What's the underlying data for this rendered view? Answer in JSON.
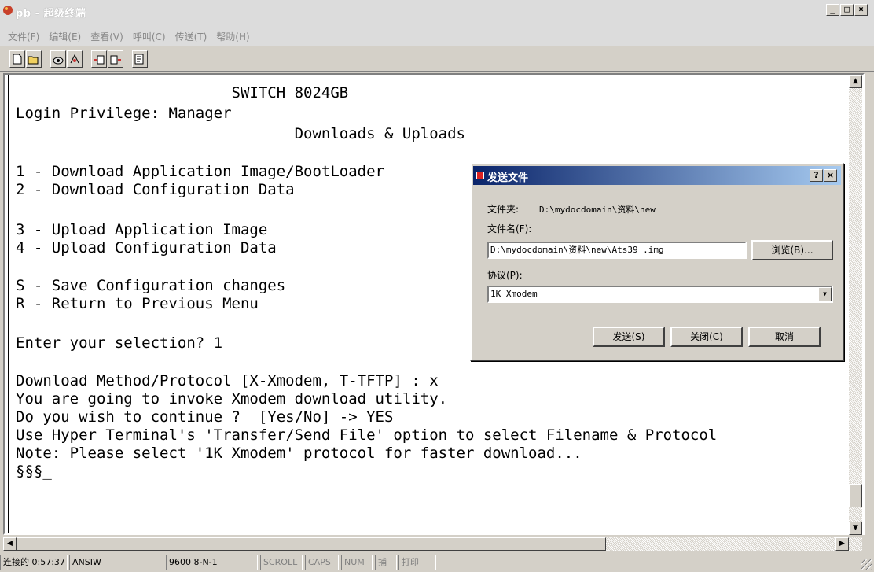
{
  "window": {
    "title": "pb - 超级终端",
    "minimize": "_",
    "maximize": "□",
    "close": "×"
  },
  "menu": [
    "文件(F)",
    "编辑(E)",
    "查看(V)",
    "呼叫(C)",
    "传送(T)",
    "帮助(H)"
  ],
  "toolbar": {
    "icons": [
      "new-icon",
      "open-icon",
      "call-icon",
      "disconnect-icon",
      "send-icon",
      "receive-icon",
      "properties-icon"
    ]
  },
  "terminal": {
    "lines": [
      "                        SWITCH 8024GB",
      "Login Privilege: Manager",
      "                               Downloads & Uploads",
      "",
      "1 - Download Application Image/BootLoader",
      "2 - Download Configuration Data",
      "",
      "3 - Upload Application Image",
      "4 - Upload Configuration Data",
      "",
      "S - Save Configuration changes",
      "R - Return to Previous Menu",
      "",
      "Enter your selection? 1",
      "",
      "Download Method/Protocol [X-Xmodem, T-TFTP] : x",
      "You are going to invoke Xmodem download utility.",
      "Do you wish to continue ?  [Yes/No] -> YES",
      "Use Hyper Terminal's 'Transfer/Send File' option to select Filename & Protocol",
      "Note: Please select '1K Xmodem' protocol for faster download...",
      "§§§_"
    ]
  },
  "dialog": {
    "title": "发送文件",
    "help_btn": "?",
    "close_btn": "×",
    "folder_label": "文件夹:",
    "folder_value": "D:\\mydocdomain\\资料\\new",
    "filename_label": "文件名(F):",
    "filename_value": "D:\\mydocdomain\\资料\\new\\Ats39 .img",
    "browse_label": "浏览(B)...",
    "protocol_label": "协议(P):",
    "protocol_value": "1K Xmodem",
    "send_label": "发送(S)",
    "close_label": "关闭(C)",
    "cancel_label": "取消"
  },
  "statusbar": {
    "connected": "连接的 0:57:37",
    "emulation": "ANSIW",
    "settings": "9600 8-N-1",
    "scroll": "SCROLL",
    "caps": "CAPS",
    "num": "NUM",
    "capture": "捕",
    "print": "打印"
  }
}
